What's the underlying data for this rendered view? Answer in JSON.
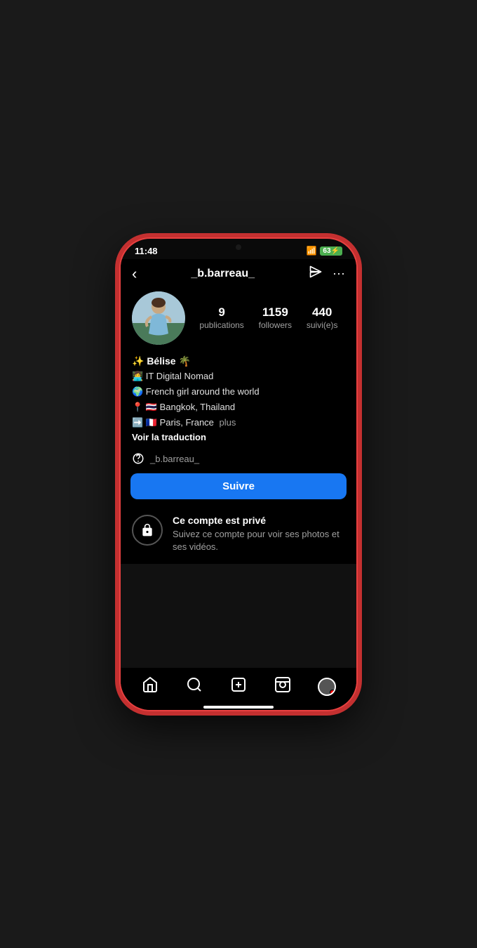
{
  "phone": {
    "time": "11:48",
    "battery": "63",
    "battery_icon": "63⚡"
  },
  "header": {
    "back_label": "‹",
    "username": "_b.barreau_",
    "send_icon": "send",
    "more_icon": "···"
  },
  "stats": {
    "publications_count": "9",
    "publications_label": "publications",
    "followers_count": "1159",
    "followers_label": "followers",
    "following_count": "440",
    "following_label": "suivi(e)s"
  },
  "bio": {
    "name_line": "✨ Bélise 🌴",
    "line1": "👩‍💻 IT Digital Nomad",
    "line2": "🌍 French girl around the world",
    "line3": "📍 🇹🇭 Bangkok, Thailand",
    "line4": "➡️ 🇫🇷 Paris, France",
    "plus_label": "plus",
    "translate_label": "Voir la traduction"
  },
  "threads": {
    "username": "_b.barreau_"
  },
  "suivre": {
    "label": "Suivre"
  },
  "private": {
    "title": "Ce compte est privé",
    "description": "Suivez ce compte pour voir ses photos et ses vidéos."
  },
  "nav": {
    "home_label": "home",
    "search_label": "search",
    "add_label": "add",
    "reels_label": "reels",
    "profile_label": "profile"
  }
}
